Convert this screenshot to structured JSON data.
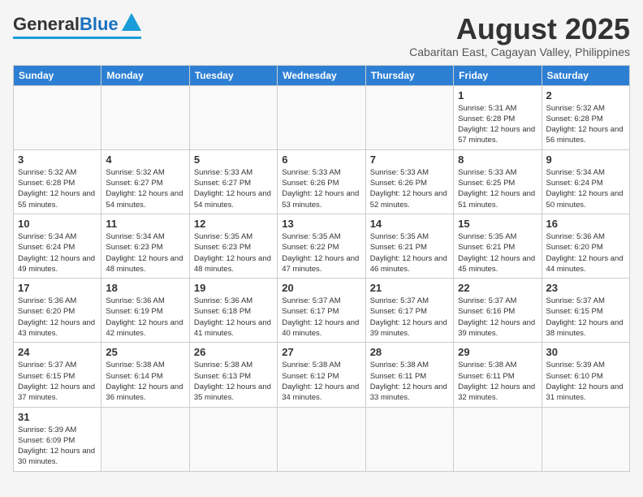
{
  "header": {
    "logo_general": "General",
    "logo_blue": "Blue",
    "main_title": "August 2025",
    "subtitle": "Cabaritan East, Cagayan Valley, Philippines"
  },
  "days": [
    "Sunday",
    "Monday",
    "Tuesday",
    "Wednesday",
    "Thursday",
    "Friday",
    "Saturday"
  ],
  "weeks": [
    [
      {
        "date": "",
        "info": ""
      },
      {
        "date": "",
        "info": ""
      },
      {
        "date": "",
        "info": ""
      },
      {
        "date": "",
        "info": ""
      },
      {
        "date": "",
        "info": ""
      },
      {
        "date": "1",
        "info": "Sunrise: 5:31 AM\nSunset: 6:28 PM\nDaylight: 12 hours\nand 57 minutes."
      },
      {
        "date": "2",
        "info": "Sunrise: 5:32 AM\nSunset: 6:28 PM\nDaylight: 12 hours\nand 56 minutes."
      }
    ],
    [
      {
        "date": "3",
        "info": "Sunrise: 5:32 AM\nSunset: 6:28 PM\nDaylight: 12 hours\nand 55 minutes."
      },
      {
        "date": "4",
        "info": "Sunrise: 5:32 AM\nSunset: 6:27 PM\nDaylight: 12 hours\nand 54 minutes."
      },
      {
        "date": "5",
        "info": "Sunrise: 5:33 AM\nSunset: 6:27 PM\nDaylight: 12 hours\nand 54 minutes."
      },
      {
        "date": "6",
        "info": "Sunrise: 5:33 AM\nSunset: 6:26 PM\nDaylight: 12 hours\nand 53 minutes."
      },
      {
        "date": "7",
        "info": "Sunrise: 5:33 AM\nSunset: 6:26 PM\nDaylight: 12 hours\nand 52 minutes."
      },
      {
        "date": "8",
        "info": "Sunrise: 5:33 AM\nSunset: 6:25 PM\nDaylight: 12 hours\nand 51 minutes."
      },
      {
        "date": "9",
        "info": "Sunrise: 5:34 AM\nSunset: 6:24 PM\nDaylight: 12 hours\nand 50 minutes."
      }
    ],
    [
      {
        "date": "10",
        "info": "Sunrise: 5:34 AM\nSunset: 6:24 PM\nDaylight: 12 hours\nand 49 minutes."
      },
      {
        "date": "11",
        "info": "Sunrise: 5:34 AM\nSunset: 6:23 PM\nDaylight: 12 hours\nand 48 minutes."
      },
      {
        "date": "12",
        "info": "Sunrise: 5:35 AM\nSunset: 6:23 PM\nDaylight: 12 hours\nand 48 minutes."
      },
      {
        "date": "13",
        "info": "Sunrise: 5:35 AM\nSunset: 6:22 PM\nDaylight: 12 hours\nand 47 minutes."
      },
      {
        "date": "14",
        "info": "Sunrise: 5:35 AM\nSunset: 6:21 PM\nDaylight: 12 hours\nand 46 minutes."
      },
      {
        "date": "15",
        "info": "Sunrise: 5:35 AM\nSunset: 6:21 PM\nDaylight: 12 hours\nand 45 minutes."
      },
      {
        "date": "16",
        "info": "Sunrise: 5:36 AM\nSunset: 6:20 PM\nDaylight: 12 hours\nand 44 minutes."
      }
    ],
    [
      {
        "date": "17",
        "info": "Sunrise: 5:36 AM\nSunset: 6:20 PM\nDaylight: 12 hours\nand 43 minutes."
      },
      {
        "date": "18",
        "info": "Sunrise: 5:36 AM\nSunset: 6:19 PM\nDaylight: 12 hours\nand 42 minutes."
      },
      {
        "date": "19",
        "info": "Sunrise: 5:36 AM\nSunset: 6:18 PM\nDaylight: 12 hours\nand 41 minutes."
      },
      {
        "date": "20",
        "info": "Sunrise: 5:37 AM\nSunset: 6:17 PM\nDaylight: 12 hours\nand 40 minutes."
      },
      {
        "date": "21",
        "info": "Sunrise: 5:37 AM\nSunset: 6:17 PM\nDaylight: 12 hours\nand 39 minutes."
      },
      {
        "date": "22",
        "info": "Sunrise: 5:37 AM\nSunset: 6:16 PM\nDaylight: 12 hours\nand 39 minutes."
      },
      {
        "date": "23",
        "info": "Sunrise: 5:37 AM\nSunset: 6:15 PM\nDaylight: 12 hours\nand 38 minutes."
      }
    ],
    [
      {
        "date": "24",
        "info": "Sunrise: 5:37 AM\nSunset: 6:15 PM\nDaylight: 12 hours\nand 37 minutes."
      },
      {
        "date": "25",
        "info": "Sunrise: 5:38 AM\nSunset: 6:14 PM\nDaylight: 12 hours\nand 36 minutes."
      },
      {
        "date": "26",
        "info": "Sunrise: 5:38 AM\nSunset: 6:13 PM\nDaylight: 12 hours\nand 35 minutes."
      },
      {
        "date": "27",
        "info": "Sunrise: 5:38 AM\nSunset: 6:12 PM\nDaylight: 12 hours\nand 34 minutes."
      },
      {
        "date": "28",
        "info": "Sunrise: 5:38 AM\nSunset: 6:11 PM\nDaylight: 12 hours\nand 33 minutes."
      },
      {
        "date": "29",
        "info": "Sunrise: 5:38 AM\nSunset: 6:11 PM\nDaylight: 12 hours\nand 32 minutes."
      },
      {
        "date": "30",
        "info": "Sunrise: 5:39 AM\nSunset: 6:10 PM\nDaylight: 12 hours\nand 31 minutes."
      }
    ],
    [
      {
        "date": "31",
        "info": "Sunrise: 5:39 AM\nSunset: 6:09 PM\nDaylight: 12 hours\nand 30 minutes."
      },
      {
        "date": "",
        "info": ""
      },
      {
        "date": "",
        "info": ""
      },
      {
        "date": "",
        "info": ""
      },
      {
        "date": "",
        "info": ""
      },
      {
        "date": "",
        "info": ""
      },
      {
        "date": "",
        "info": ""
      }
    ]
  ]
}
